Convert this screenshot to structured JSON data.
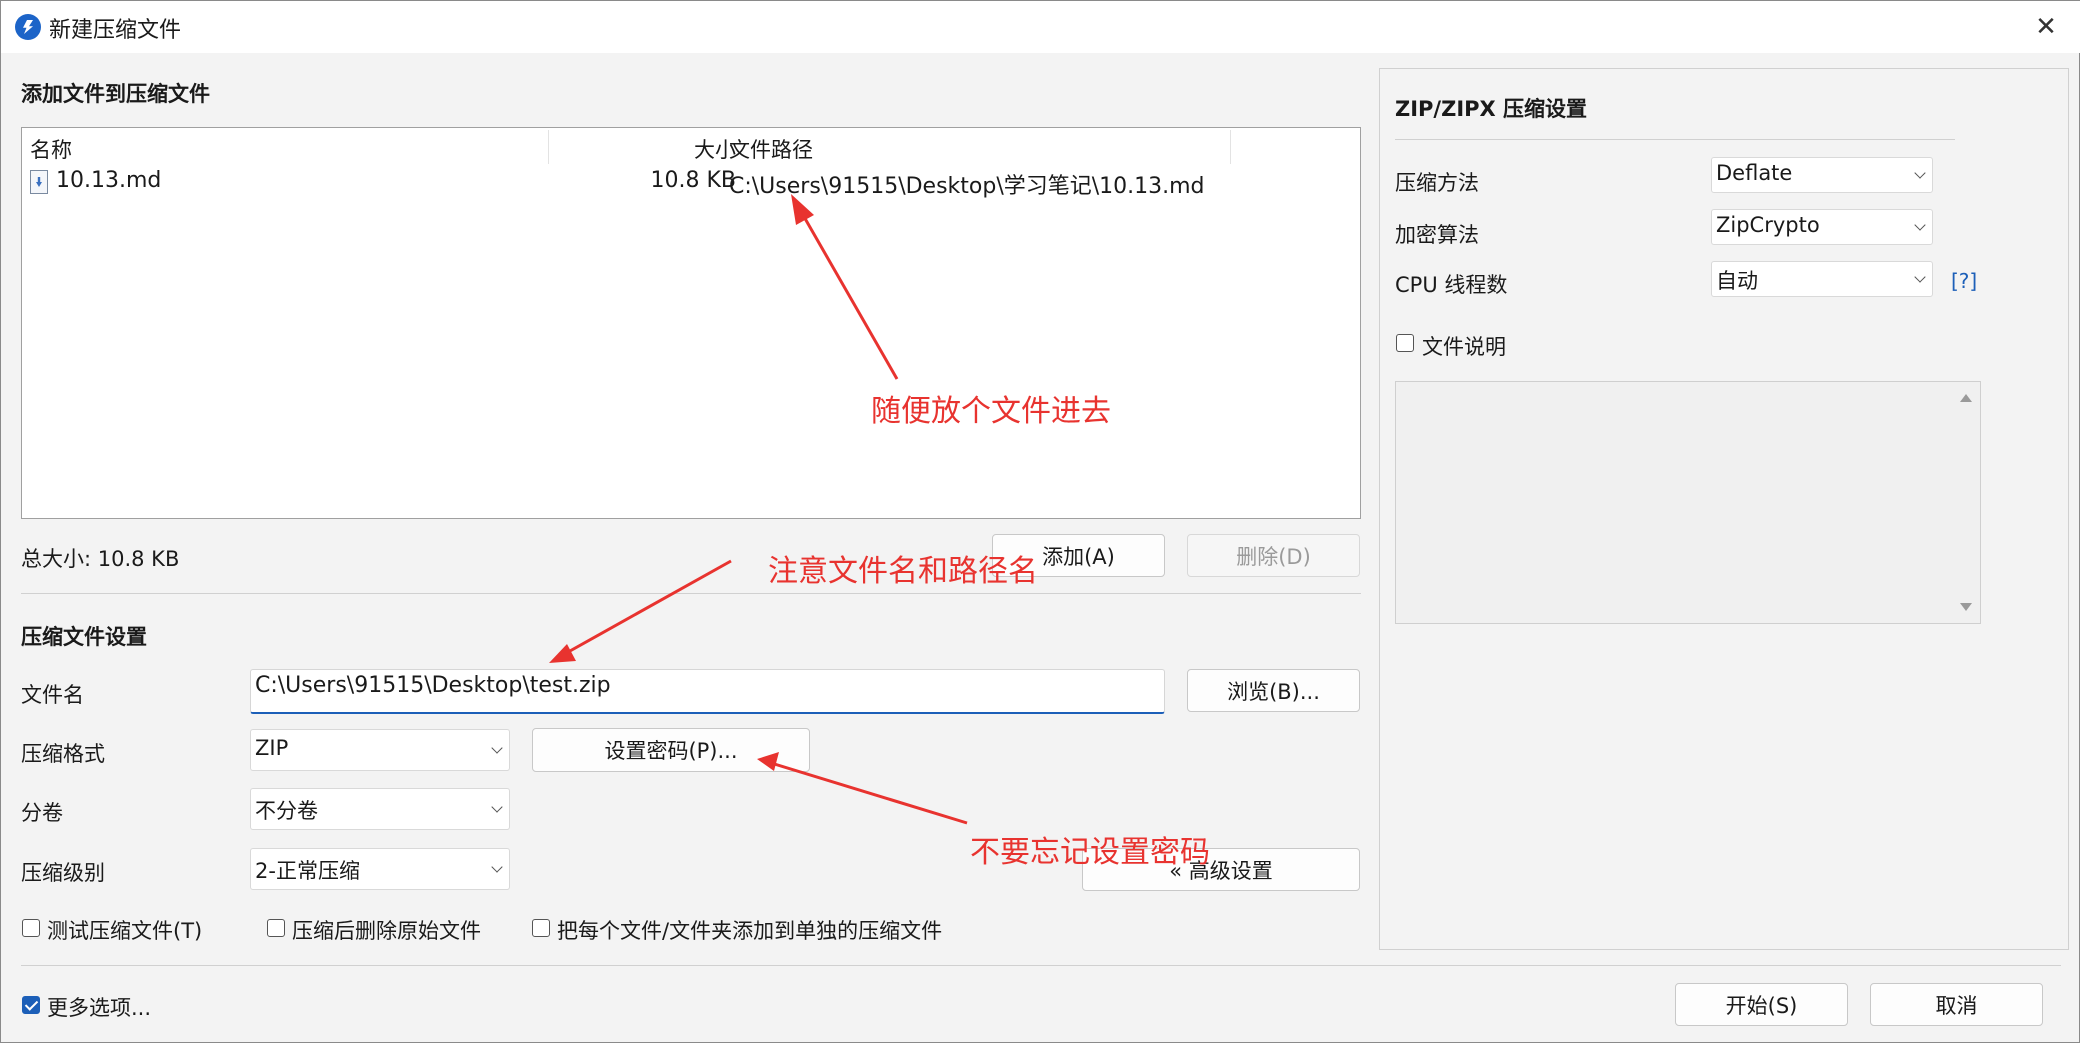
{
  "titlebar": {
    "title": "新建压缩文件",
    "close_icon": "✕"
  },
  "add_section": {
    "title": "添加文件到压缩文件",
    "columns": {
      "name": "名称",
      "size": "大小",
      "path": "文件路径"
    },
    "rows": [
      {
        "name": "10.13.md",
        "size": "10.8 KB",
        "path": "C:\\Users\\91515\\Desktop\\学习笔记\\10.13.md"
      }
    ],
    "total_size": "总大小: 10.8 KB",
    "add_button": "添加(A)",
    "delete_button": "删除(D)"
  },
  "archive_settings": {
    "title": "压缩文件设置",
    "filename_label": "文件名",
    "filename_value": "C:\\Users\\91515\\Desktop\\test.zip",
    "browse_button": "浏览(B)...",
    "format_label": "压缩格式",
    "format_value": "ZIP",
    "set_password_button": "设置密码(P)...",
    "split_label": "分卷",
    "split_value": "不分卷",
    "level_label": "压缩级别",
    "level_value": "2-正常压缩",
    "advanced_button": "« 高级设置",
    "checkboxes": [
      {
        "label": "测试压缩文件(T)",
        "checked": false
      },
      {
        "label": "压缩后删除原始文件",
        "checked": false
      },
      {
        "label": "把每个文件/文件夹添加到单独的压缩文件",
        "checked": false
      }
    ]
  },
  "footer": {
    "more_options_label": "更多选项...",
    "more_options_checked": true,
    "start_button": "开始(S)",
    "cancel_button": "取消"
  },
  "zip_settings": {
    "title": "ZIP/ZIPX 压缩设置",
    "method_label": "压缩方法",
    "method_value": "Deflate",
    "encryption_label": "加密算法",
    "encryption_value": "ZipCrypto",
    "cpu_label": "CPU 线程数",
    "cpu_value": "自动",
    "help_link": "[?]",
    "comment_label": "文件说明",
    "comment_checked": false
  },
  "annotations": {
    "note1": "随便放个文件进去",
    "note2": "注意文件名和路径名",
    "note3": "不要忘记设置密码"
  },
  "colors": {
    "accent": "#1c5fb8",
    "annotation": "#e8332f"
  }
}
